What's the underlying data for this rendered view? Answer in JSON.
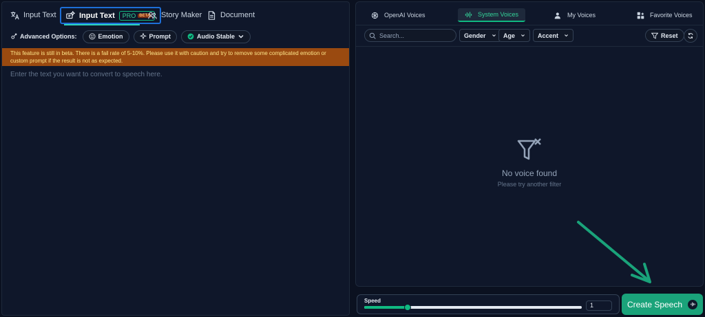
{
  "left": {
    "tabs": [
      {
        "label": "Input Text",
        "icon": "translate-icon"
      },
      {
        "label": "Input Text",
        "icon": "magic-text-icon",
        "badge": "PRO",
        "badge_sub": "BETA"
      },
      {
        "label": "Story Maker",
        "icon": "people-icon"
      },
      {
        "label": "Document",
        "icon": "document-icon"
      }
    ],
    "options_label": "Advanced Options:",
    "options": [
      {
        "label": "Emotion",
        "icon": "emotion-icon"
      },
      {
        "label": "Prompt",
        "icon": "sparkle-icon"
      },
      {
        "label": "Audio Stable",
        "icon": "check-circle-icon"
      }
    ],
    "warning": "This feature is still in beta. There is a fail rate of 5-10%. Please use it with caution and try to remove some complicated emotion or custom prompt if the result is not as expected.",
    "text_placeholder": "Enter the text you want to convert to speech here."
  },
  "right": {
    "tabs": [
      {
        "label": "OpenAI Voices",
        "icon": "openai-icon"
      },
      {
        "label": "System Voices",
        "icon": "waveform-icon"
      },
      {
        "label": "My Voices",
        "icon": "user-voice-icon"
      },
      {
        "label": "Favorite Voices",
        "icon": "favorite-icon"
      }
    ],
    "search_placeholder": "Search...",
    "filters": [
      "Gender",
      "Age",
      "Accent"
    ],
    "reset_label": "Reset",
    "empty_title": "No voice found",
    "empty_subtitle": "Please try another filter"
  },
  "speed": {
    "label": "Speed",
    "value": "1",
    "slider_fraction": 0.2
  },
  "create_button": "Create Speech",
  "colors": {
    "accent": "#10b981",
    "warning_bg": "#9a4a10",
    "active_border": "#1d6fd8",
    "background": "#0f172a"
  }
}
